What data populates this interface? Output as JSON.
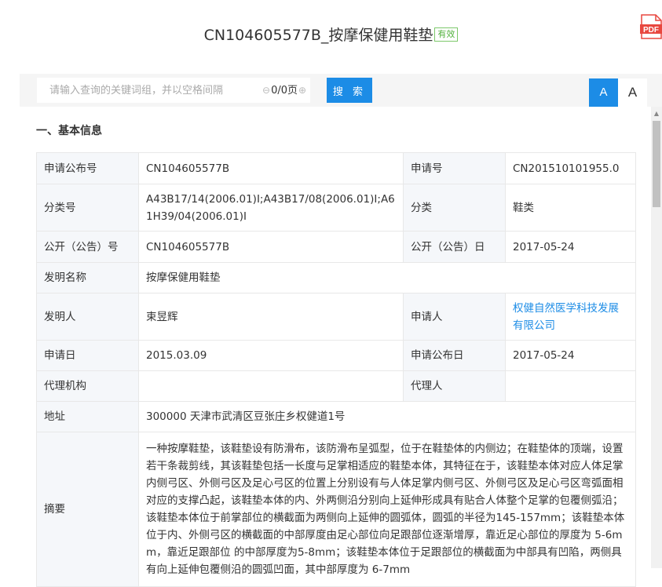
{
  "header": {
    "title": "CN104605577B_按摩保健用鞋垫",
    "status_badge": "有效",
    "pdf_icon": "pdf-icon"
  },
  "toolbar": {
    "search_placeholder": "请输入查询的关键词组，并以空格间隔",
    "pager_text": "0/0页",
    "search_label": "搜 索",
    "font_large_label": "A",
    "font_small_label": "A"
  },
  "section": {
    "title": "一、基本信息"
  },
  "fields": {
    "pub_no_label": "申请公布号",
    "pub_no": "CN104605577B",
    "app_no_label": "申请号",
    "app_no": "CN201510101955.0",
    "class_no_label": "分类号",
    "class_no": "A43B17/14(2006.01)I;A43B17/08(2006.01)I;A61H39/04(2006.01)I",
    "class_label": "分类",
    "class": "鞋类",
    "open_no_label": "公开（公告）号",
    "open_no": "CN104605577B",
    "open_date_label": "公开（公告）日",
    "open_date": "2017-05-24",
    "name_label": "发明名称",
    "name": "按摩保健用鞋垫",
    "inventor_label": "发明人",
    "inventor": "束昱辉",
    "applicant_label": "申请人",
    "applicant": "权健自然医学科技发展有限公司",
    "app_date_label": "申请日",
    "app_date": "2015.03.09",
    "app_pub_date_label": "申请公布日",
    "app_pub_date": "2017-05-24",
    "agency_label": "代理机构",
    "agency": "",
    "agent_label": "代理人",
    "agent": "",
    "address_label": "地址",
    "address": "300000 天津市武清区豆张庄乡权健道1号",
    "abstract_label": "摘要",
    "abstract": "一种按摩鞋垫，该鞋垫设有防滑布，该防滑布呈弧型，位于在鞋垫体的内侧边；在鞋垫体的顶端，设置若干条裁剪线，其该鞋垫包括一长度与足掌相适应的鞋垫本体，其特征在于，该鞋垫本体对应人体足掌内侧弓区、外侧弓区及足心弓区的位置上分别设有与人体足掌内侧弓区、外侧弓区及足心弓区弯弧面相对应的支撑凸起，该鞋垫本体的内、外两侧沿分别向上延伸形成具有贴合人体整个足掌的包覆侧弧沿；该鞋垫本体位于前掌部位的横截面为两侧向上延伸的圆弧体，圆弧的半径为145-157mm；该鞋垫本体位于内、外侧弓区的横截面的中部厚度由足心部位向足跟部位逐渐增厚，靠近足心部位的厚度为 5-6mm，靠近足跟部位 的中部厚度为5-8mm；该鞋垫本体位于足跟部位的横截面为中部具有凹陷，两侧具有向上延伸包覆侧沿的圆弧凹面，其中部厚度为 6-7mm"
  }
}
